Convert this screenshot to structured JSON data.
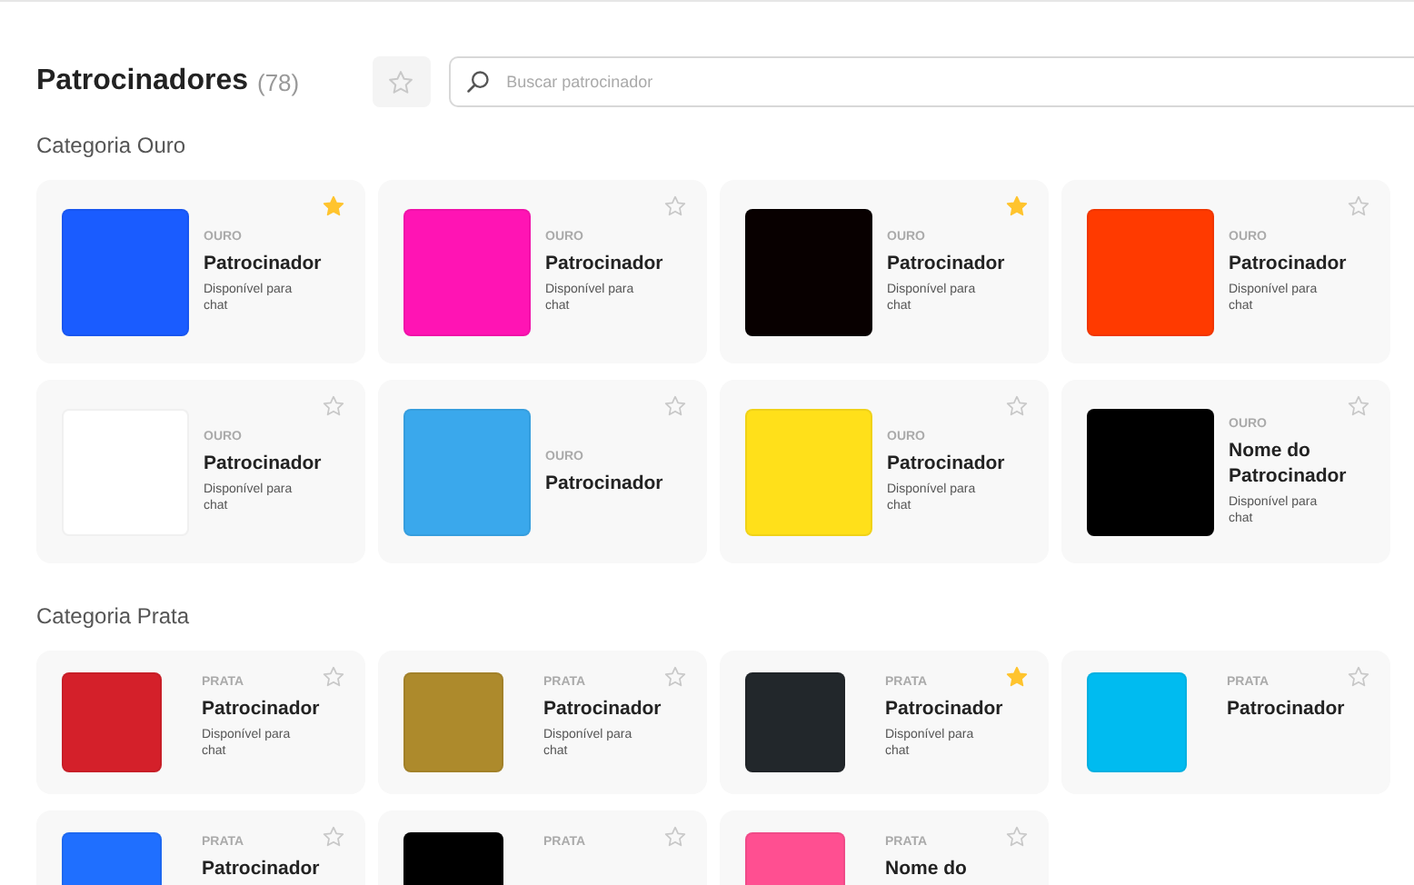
{
  "header": {
    "title": "Patrocinadores",
    "count": "(78)",
    "favorites_filter": {
      "selected": false
    },
    "search": {
      "placeholder": "Buscar patrocinador"
    }
  },
  "sections": [
    {
      "title": "Categoria Ouro",
      "kind": "gold",
      "sponsors": [
        {
          "tier": "OURO",
          "name": "Patrocinador",
          "note": "Disponível para chat",
          "color": "#1a5cff",
          "favorite": true
        },
        {
          "tier": "OURO",
          "name": "Patrocinador",
          "note": "Disponível para chat",
          "color": "#ff14b4",
          "favorite": false
        },
        {
          "tier": "OURO",
          "name": "Patrocinador",
          "note": "Disponível para chat",
          "color": "#080000",
          "favorite": true
        },
        {
          "tier": "OURO",
          "name": "Patrocinador",
          "note": "Disponível para chat",
          "color": "#ff3a00",
          "favorite": false
        },
        {
          "tier": "OURO",
          "name": "Patrocinador",
          "note": "Disponível para chat",
          "color": "#ffffff",
          "favorite": false
        },
        {
          "tier": "OURO",
          "name": "Patrocinador",
          "color": "#3aa8ec",
          "favorite": false
        },
        {
          "tier": "OURO",
          "name": "Patrocinador",
          "note": "Disponível para chat",
          "color": "#ffe01a",
          "favorite": false
        },
        {
          "tier": "OURO",
          "name": "Nome do Patrocinador",
          "note": "Disponível para chat",
          "color": "#000000",
          "favorite": false
        }
      ]
    },
    {
      "title": "Categoria Prata",
      "kind": "silver",
      "sponsors": [
        {
          "tier": "PRATA",
          "name": "Patrocinador",
          "note": "Disponível para chat",
          "color": "#d4202a",
          "favorite": false
        },
        {
          "tier": "PRATA",
          "name": "Patrocinador",
          "note": "Disponível para chat",
          "color": "#ad8a2c",
          "favorite": false
        },
        {
          "tier": "PRATA",
          "name": "Patrocinador",
          "note": "Disponível para chat",
          "color": "#22272b",
          "favorite": true
        },
        {
          "tier": "PRATA",
          "name": "Patrocinador",
          "color": "#00bbf0",
          "favorite": false
        },
        {
          "tier": "PRATA",
          "name": "Patrocinador",
          "color": "#1f6fff",
          "favorite": false
        },
        {
          "tier": "PRATA",
          "color": "#000000",
          "favorite": false
        },
        {
          "tier": "PRATA",
          "name": "Nome do",
          "color": "#ff4f91",
          "favorite": false
        }
      ]
    }
  ]
}
